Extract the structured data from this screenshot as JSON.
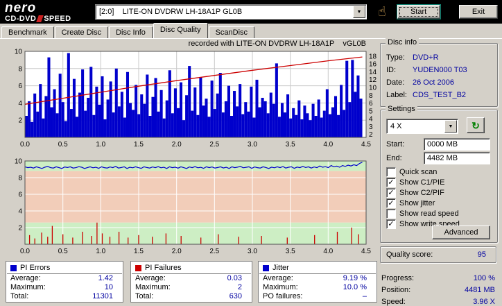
{
  "header": {
    "logo_nero": "nero",
    "logo_cddvd": "CD-DVD",
    "logo_speed": "SPEED",
    "drive": "[2:0]    LITE-ON DVDRW LH-18A1P GL0B",
    "start_label": "Start",
    "exit_label": "Exit"
  },
  "icons": {
    "dropdown": "▼",
    "refresh": "↻",
    "hand": "☝",
    "check": "✓"
  },
  "tabs": {
    "items": [
      "Benchmark",
      "Create Disc",
      "Disc Info",
      "Disc Quality",
      "ScanDisc"
    ],
    "active_index": 3
  },
  "disc_info": {
    "title": "Disc info",
    "rows": [
      {
        "label": "Type:",
        "value": "DVD+R"
      },
      {
        "label": "ID:",
        "value": "YUDEN000 T03"
      },
      {
        "label": "Date:",
        "value": "26 Oct 2006"
      },
      {
        "label": "Label:",
        "value": "CDS_TEST_B2"
      }
    ]
  },
  "settings": {
    "title": "Settings",
    "speed": "4 X",
    "start_label": "Start:",
    "start_value": "0000 MB",
    "end_label": "End:",
    "end_value": "4482 MB",
    "checkboxes": [
      {
        "label": "Quick scan",
        "checked": false
      },
      {
        "label": "Show C1/PIE",
        "checked": true
      },
      {
        "label": "Show C2/PIF",
        "checked": true
      },
      {
        "label": "Show jitter",
        "checked": true
      },
      {
        "label": "Show read speed",
        "checked": false
      },
      {
        "label": "Show write speed",
        "checked": true
      }
    ],
    "advanced_label": "Advanced"
  },
  "quality": {
    "label": "Quality score:",
    "value": "95"
  },
  "progress": {
    "rows": [
      {
        "label": "Progress:",
        "value": "100 %"
      },
      {
        "label": "Position:",
        "value": "4481 MB"
      },
      {
        "label": "Speed:",
        "value": "3.96 X"
      }
    ]
  },
  "stats": [
    {
      "title": "PI Errors",
      "color": "#0000cc",
      "rows": [
        [
          "Average:",
          "1.42"
        ],
        [
          "Maximum:",
          "10"
        ],
        [
          "Total:",
          "11301"
        ]
      ]
    },
    {
      "title": "PI Failures",
      "color": "#cc0000",
      "rows": [
        [
          "Average:",
          "0.03"
        ],
        [
          "Maximum:",
          "2"
        ],
        [
          "Total:",
          "630"
        ]
      ]
    },
    {
      "title": "Jitter",
      "color": "#0000cc",
      "rows": [
        [
          "Average:",
          "9.19 %"
        ],
        [
          "Maximum:",
          "10.0 %"
        ],
        [
          "PO failures:",
          "–"
        ]
      ]
    }
  ],
  "colors": {
    "value_text": "#0000a0",
    "bar_blue": "#0000cc",
    "line_red": "#cc0000",
    "zone_green": "#cdeec4",
    "zone_salmon": "#f2cdb9"
  },
  "chart_data": [
    {
      "type": "bar",
      "name": "pi-errors-over-position",
      "title": "recorded with LITE-ON DVDRW LH-18A1P    vGL0B",
      "x_min": 0,
      "x_max": 4.5,
      "y_min": 0,
      "y_max": 10,
      "x_ticks": [
        "0.0",
        "0.5",
        "1.0",
        "1.5",
        "2.0",
        "2.5",
        "3.0",
        "3.5",
        "4.0",
        "4.5"
      ],
      "left_ticks": [
        10,
        8,
        6,
        4,
        2
      ],
      "right_ticks": [
        18,
        16,
        14,
        12,
        10,
        8,
        6,
        5,
        4,
        3,
        2
      ],
      "grid_y": [
        2,
        4,
        6,
        8
      ],
      "bars": {
        "color": "#0000cc",
        "x_end": 4.45,
        "values": [
          2.5,
          4.2,
          1.8,
          5.1,
          3.0,
          6.2,
          2.2,
          4.8,
          9.3,
          3.5,
          5.6,
          2.8,
          7.4,
          4.1,
          1.9,
          9.8,
          3.3,
          6.8,
          2.4,
          5.2,
          7.9,
          3.1,
          4.6,
          8.2,
          2.6,
          5.9,
          3.8,
          7.1,
          2.1,
          4.4,
          6.5,
          2.9,
          8.0,
          3.6,
          5.3,
          2.3,
          7.6,
          4.0,
          3.2,
          6.1,
          2.7,
          5.0,
          3.9,
          7.3,
          2.5,
          4.7,
          6.9,
          3.0,
          5.5,
          2.2,
          4.3,
          7.8,
          2.8,
          5.7,
          3.4,
          6.4,
          2.0,
          4.9,
          8.3,
          3.1,
          5.8,
          2.6,
          7.0,
          3.7,
          4.5,
          2.4,
          6.6,
          3.3,
          5.1,
          7.5,
          2.9,
          4.2,
          6.0,
          2.5,
          5.4,
          3.6,
          6.2,
          2.7,
          4.1,
          3.0,
          5.9,
          2.3,
          6.7,
          3.5,
          4.6,
          4.2,
          2.8,
          5.2,
          3.9,
          8.6,
          2.4,
          4.0,
          2.9,
          5.0,
          2.2,
          3.4,
          2.6,
          4.3,
          2.1,
          3.7,
          2.8,
          2.0,
          3.9,
          2.5,
          4.4,
          2.3,
          3.1,
          5.6,
          2.7,
          3.5,
          4.8,
          2.6,
          6.1,
          3.2,
          8.9,
          4.1,
          9.0,
          5.3,
          7.2,
          4.5
        ]
      },
      "line": {
        "name": "write-speed",
        "color": "#cc0000",
        "points": [
          [
            0,
            3.85
          ],
          [
            0.5,
            4.55
          ],
          [
            1.0,
            5.25
          ],
          [
            1.5,
            5.95
          ],
          [
            2.0,
            6.6
          ],
          [
            2.5,
            7.2
          ],
          [
            3.0,
            7.8
          ],
          [
            3.5,
            8.35
          ],
          [
            4.0,
            8.9
          ],
          [
            4.45,
            9.35
          ]
        ]
      }
    },
    {
      "type": "line",
      "name": "jitter-and-pi-failures",
      "x_min": 0,
      "x_max": 4.5,
      "y_min": 0,
      "y_max": 10,
      "x_ticks": [
        "0.0",
        "0.5",
        "1.0",
        "1.5",
        "2.0",
        "2.5",
        "3.0",
        "3.5",
        "4.0",
        "4.5"
      ],
      "left_ticks": [
        10,
        8,
        6,
        4,
        2
      ],
      "grid_y": [
        2,
        4,
        6,
        8
      ],
      "zones": [
        {
          "y0": 8.8,
          "y1": 10,
          "color": "#cdeec4"
        },
        {
          "y0": 2.6,
          "y1": 8.8,
          "color": "#f2cdb9"
        },
        {
          "y0": 0,
          "y1": 2.6,
          "color": "#cdeec4"
        }
      ],
      "jitter_line": {
        "color": "#0000cc",
        "x_end": 4.45,
        "values": [
          9.3,
          9.2,
          9.25,
          9.15,
          9.3,
          9.2,
          9.1,
          9.25,
          9.35,
          9.2,
          9.15,
          9.3,
          9.2,
          9.1,
          9.28,
          9.22,
          9.3,
          9.15,
          9.2,
          9.32,
          9.25,
          9.1,
          9.2,
          9.3,
          9.18,
          9.25,
          9.12,
          9.3,
          9.2,
          9.15,
          9.28,
          9.2,
          9.35,
          9.15,
          9.22,
          9.3,
          9.1,
          9.25,
          9.18,
          9.3,
          9.2,
          9.12,
          9.3,
          9.22,
          9.15,
          9.28,
          9.2,
          9.32,
          9.18,
          9.25,
          9.1,
          9.3,
          9.2,
          9.26,
          9.14,
          9.3,
          9.2,
          9.1,
          9.28,
          9.2,
          9.32,
          9.18,
          9.24,
          9.12,
          9.3,
          9.2,
          9.28,
          9.15,
          9.22,
          9.3,
          9.16,
          9.25,
          9.1,
          9.3,
          9.2,
          9.26,
          9.35,
          9.18,
          9.24,
          9.3,
          9.12,
          9.28,
          9.2,
          9.15,
          9.3,
          9.22,
          9.1,
          9.26,
          9.18,
          9.3,
          9.2,
          9.33,
          9.15,
          9.25,
          9.3,
          9.12,
          9.27,
          9.2,
          9.35,
          9.22,
          9.3,
          9.15,
          9.28,
          9.2,
          9.4,
          9.25,
          9.32,
          9.2,
          9.45,
          9.3,
          9.38,
          9.25,
          9.45,
          9.35,
          9.5,
          9.4,
          9.55,
          9.45,
          9.7,
          9.85
        ]
      },
      "spikes": {
        "name": "pi-failures",
        "color": "#cc0000",
        "points": [
          [
            0.06,
            1.1
          ],
          [
            0.13,
            0.7
          ],
          [
            0.22,
            1.4
          ],
          [
            0.3,
            0.9
          ],
          [
            0.36,
            2.2
          ],
          [
            0.5,
            1.2
          ],
          [
            0.63,
            0.8
          ],
          [
            0.76,
            1.5
          ],
          [
            0.88,
            1.0
          ],
          [
            0.95,
            2.6
          ],
          [
            1.02,
            1.3
          ],
          [
            1.12,
            0.9
          ],
          [
            1.24,
            1.5
          ],
          [
            1.36,
            0.8
          ],
          [
            1.5,
            1.1
          ],
          [
            1.68,
            0.9
          ],
          [
            1.86,
            1.3
          ],
          [
            2.06,
            1.0
          ],
          [
            2.32,
            0.8
          ],
          [
            2.55,
            1.2
          ],
          [
            2.82,
            0.9
          ],
          [
            3.12,
            1.0
          ],
          [
            3.46,
            0.8
          ],
          [
            3.82,
            1.1
          ],
          [
            4.12,
            1.5
          ],
          [
            4.31,
            2.0
          ],
          [
            4.4,
            1.2
          ]
        ]
      }
    }
  ]
}
